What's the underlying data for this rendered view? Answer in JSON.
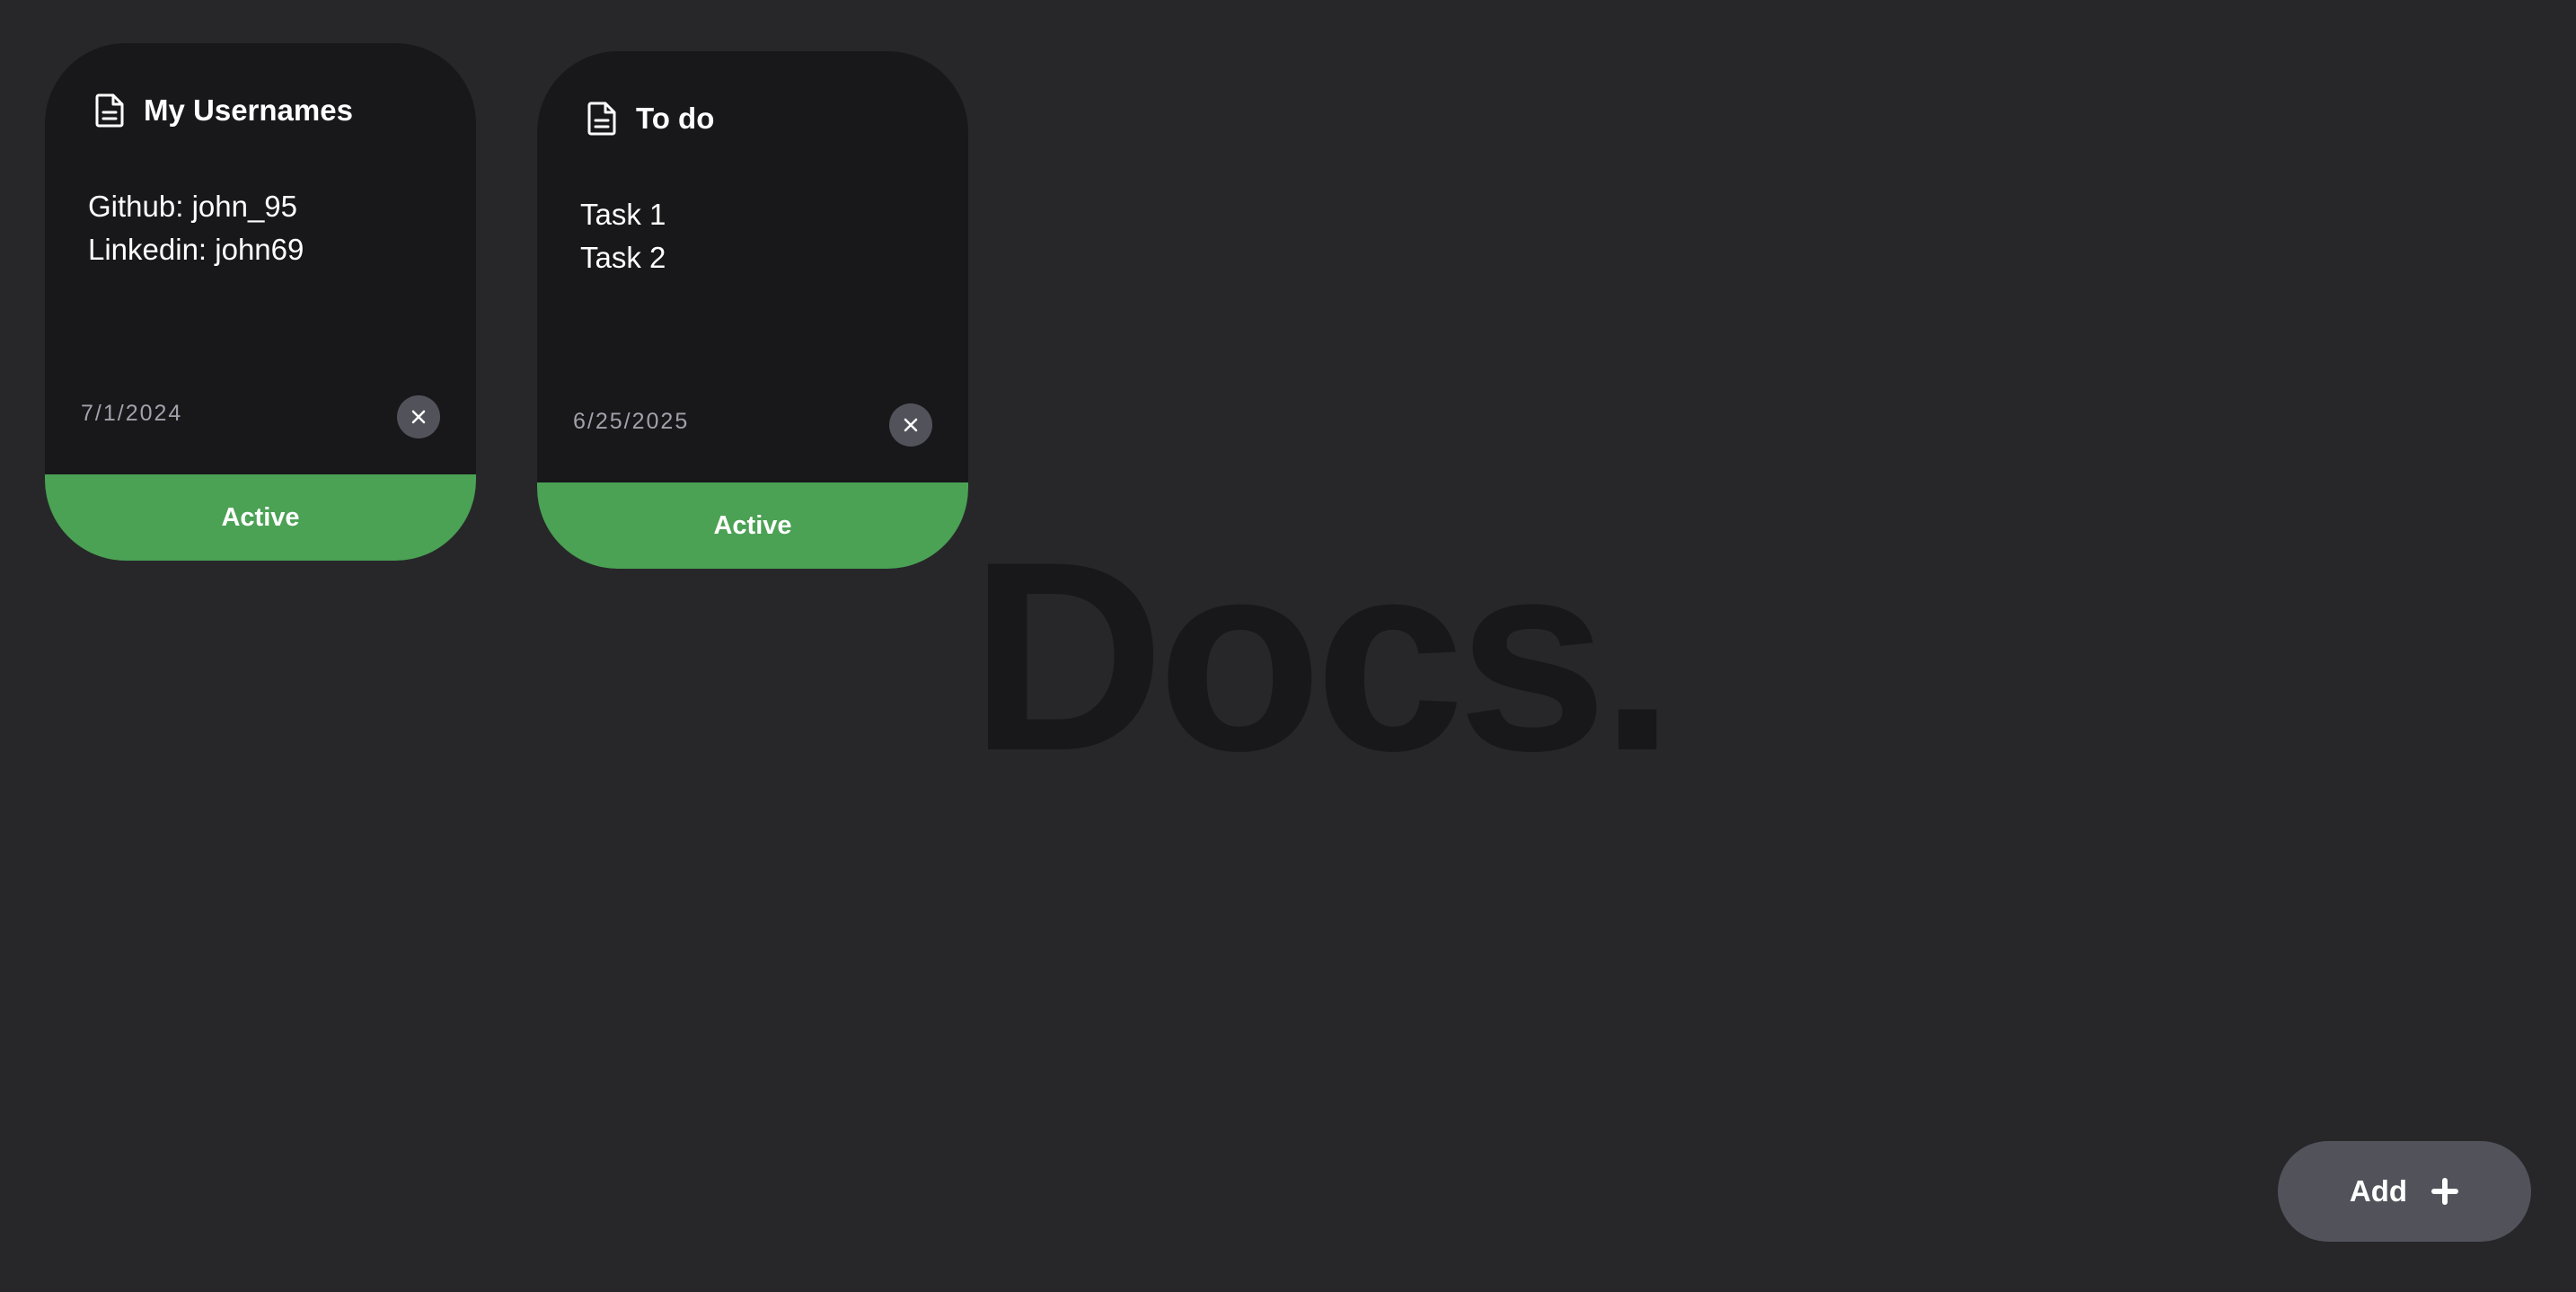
{
  "background_watermark": "Docs.",
  "colors": {
    "page_background": "#27272a",
    "card_background": "#18181b",
    "status_active": "#4ba154",
    "button_background": "#52525b",
    "date_text": "#a1a1aa"
  },
  "cards": [
    {
      "title": "My Usernames",
      "icon": "document-icon",
      "lines": [
        "Github: john_95",
        "Linkedin: john69"
      ],
      "date": "7/1/2024",
      "status": "Active",
      "delete_icon": "close-icon"
    },
    {
      "title": "To do",
      "icon": "document-icon",
      "lines": [
        "Task 1",
        "Task 2"
      ],
      "date": "6/25/2025",
      "status": "Active",
      "delete_icon": "close-icon"
    }
  ],
  "add_button": {
    "label": "Add",
    "icon": "plus-icon"
  }
}
